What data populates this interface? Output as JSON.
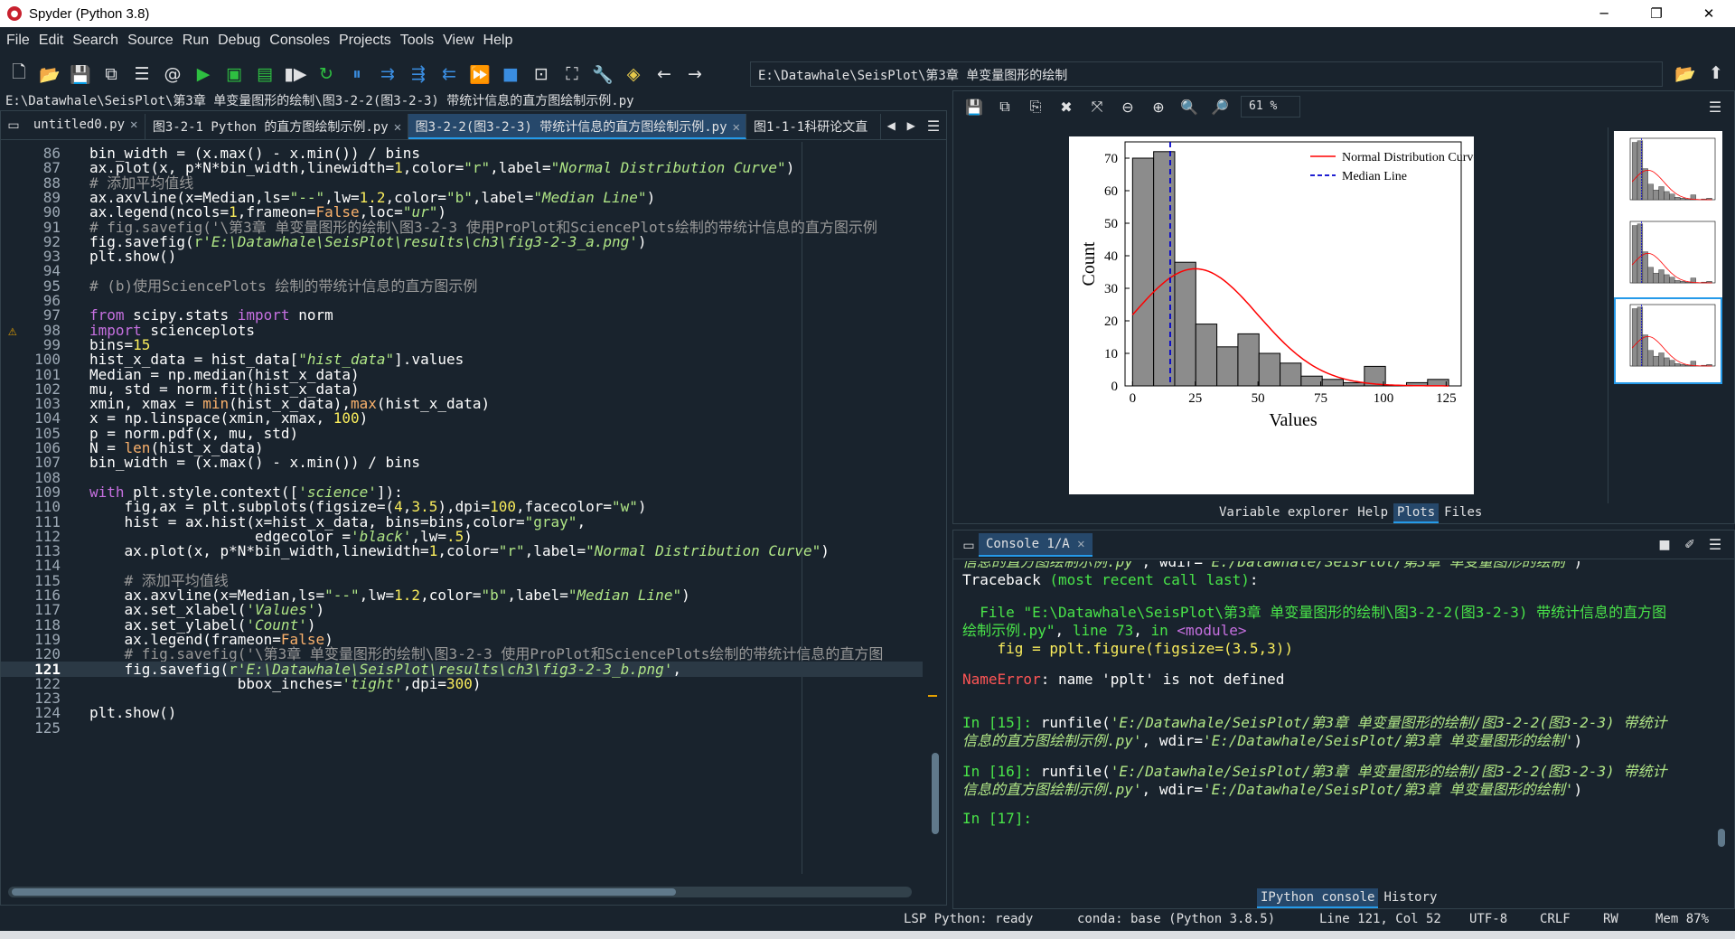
{
  "window": {
    "title": "Spyder (Python 3.8)"
  },
  "menu": [
    "File",
    "Edit",
    "Search",
    "Source",
    "Run",
    "Debug",
    "Consoles",
    "Projects",
    "Tools",
    "View",
    "Help"
  ],
  "toolbar": {
    "path": "E:\\Datawhale\\SeisPlot\\第3章  单变量图形的绘制"
  },
  "editor": {
    "file_path": "E:\\Datawhale\\SeisPlot\\第3章  单变量图形的绘制\\图3-2-2(图3-2-3) 带统计信息的直方图绘制示例.py",
    "tabs": [
      {
        "label": "untitled0.py",
        "close": "✕",
        "active": false
      },
      {
        "label": "图3-2-1 Python 的直方图绘制示例.py",
        "close": "✕",
        "active": false
      },
      {
        "label": "图3-2-2(图3-2-3) 带统计信息的直方图绘制示例.py",
        "close": "✕",
        "active": true
      },
      {
        "label": "图1-1-1科研论文直",
        "close": "",
        "active": false
      }
    ],
    "current_line": "121"
  },
  "plots": {
    "zoom": "61 %",
    "tabs": [
      "Variable explorer",
      "Help",
      "Plots",
      "Files"
    ],
    "active_tab": "Plots"
  },
  "chart_data": {
    "type": "bar",
    "xlabel": "Values",
    "ylabel": "Count",
    "xticks": [
      "0",
      "25",
      "50",
      "75",
      "100",
      "125"
    ],
    "yticks": [
      "0",
      "10",
      "20",
      "30",
      "40",
      "50",
      "60",
      "70"
    ],
    "xlim": [
      -3,
      131
    ],
    "ylim": [
      0,
      75
    ],
    "bins": [
      {
        "x0": 0,
        "x1": 8.4,
        "count": 70
      },
      {
        "x0": 8.4,
        "x1": 16.8,
        "count": 72
      },
      {
        "x0": 16.8,
        "x1": 25.2,
        "count": 38
      },
      {
        "x0": 25.2,
        "x1": 33.6,
        "count": 19
      },
      {
        "x0": 33.6,
        "x1": 42.0,
        "count": 12
      },
      {
        "x0": 42.0,
        "x1": 50.4,
        "count": 16
      },
      {
        "x0": 50.4,
        "x1": 58.8,
        "count": 10
      },
      {
        "x0": 58.8,
        "x1": 67.2,
        "count": 7
      },
      {
        "x0": 67.2,
        "x1": 75.6,
        "count": 3
      },
      {
        "x0": 75.6,
        "x1": 84.0,
        "count": 2
      },
      {
        "x0": 84.0,
        "x1": 92.4,
        "count": 1
      },
      {
        "x0": 92.4,
        "x1": 100.8,
        "count": 6
      },
      {
        "x0": 100.8,
        "x1": 109.2,
        "count": 0
      },
      {
        "x0": 109.2,
        "x1": 117.6,
        "count": 1
      },
      {
        "x0": 117.6,
        "x1": 126.0,
        "count": 2
      }
    ],
    "normal_curve": {
      "label": "Normal Distribution Curve",
      "color": "#ff0000",
      "mu": 25,
      "peak": 36,
      "sigma": 25
    },
    "median_line": {
      "label": "Median Line",
      "color": "#0000cc",
      "x": 15
    },
    "legend": "top-right"
  },
  "console": {
    "tab": "Console 1/A",
    "bottom_tabs": [
      "IPython console",
      "History"
    ],
    "active_bottom": "IPython console"
  },
  "status": {
    "lsp": "LSP Python: ready",
    "conda": "conda: base (Python 3.8.5)",
    "position": "Line 121, Col 52",
    "encoding": "UTF-8",
    "eol": "CRLF",
    "rw": "RW",
    "mem": "Mem 87%"
  }
}
